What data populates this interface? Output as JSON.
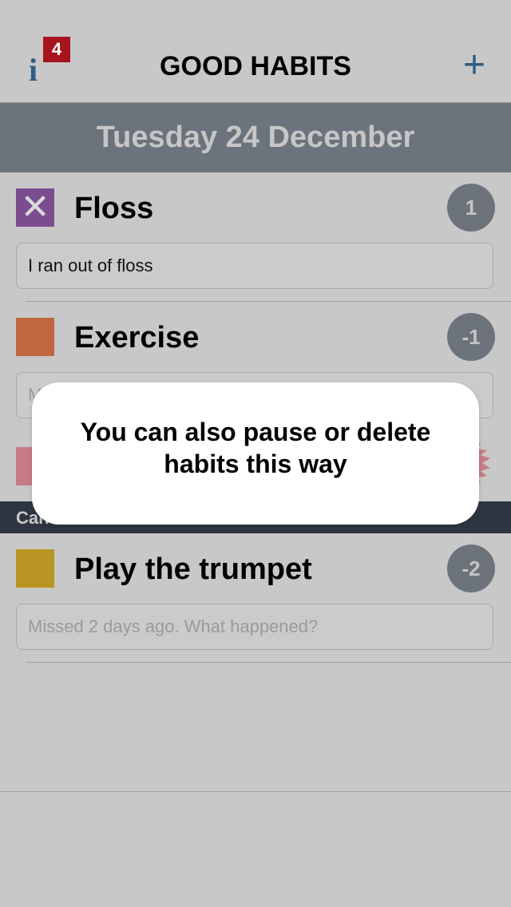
{
  "navbar": {
    "title": "GOOD HABITS",
    "info_glyph": "i",
    "info_badge": "4",
    "add_glyph": "+"
  },
  "date_header": "Tuesday 24 December",
  "habits": [
    {
      "name": "Floss",
      "color": "#7c4c91",
      "status": "missed",
      "mark": "✕",
      "streak": "1",
      "note_value": "I ran out of floss",
      "note_placeholder": ""
    },
    {
      "name": "Exercise",
      "color": "#c06640",
      "streak": "-1",
      "note_value": "",
      "note_placeholder": "M"
    },
    {
      "name": "Play the trumpet",
      "color": "#b99623",
      "streak": "-2",
      "note_value": "",
      "note_placeholder": "Missed 2 days ago. What happened?"
    }
  ],
  "hidden_row_color": "#c77b85",
  "dark_bar_text": "Can",
  "tooltip": {
    "text": "You can also pause or delete habits this way"
  },
  "icons": [
    "info-icon",
    "plus-icon",
    "close-icon",
    "starburst-icon"
  ]
}
